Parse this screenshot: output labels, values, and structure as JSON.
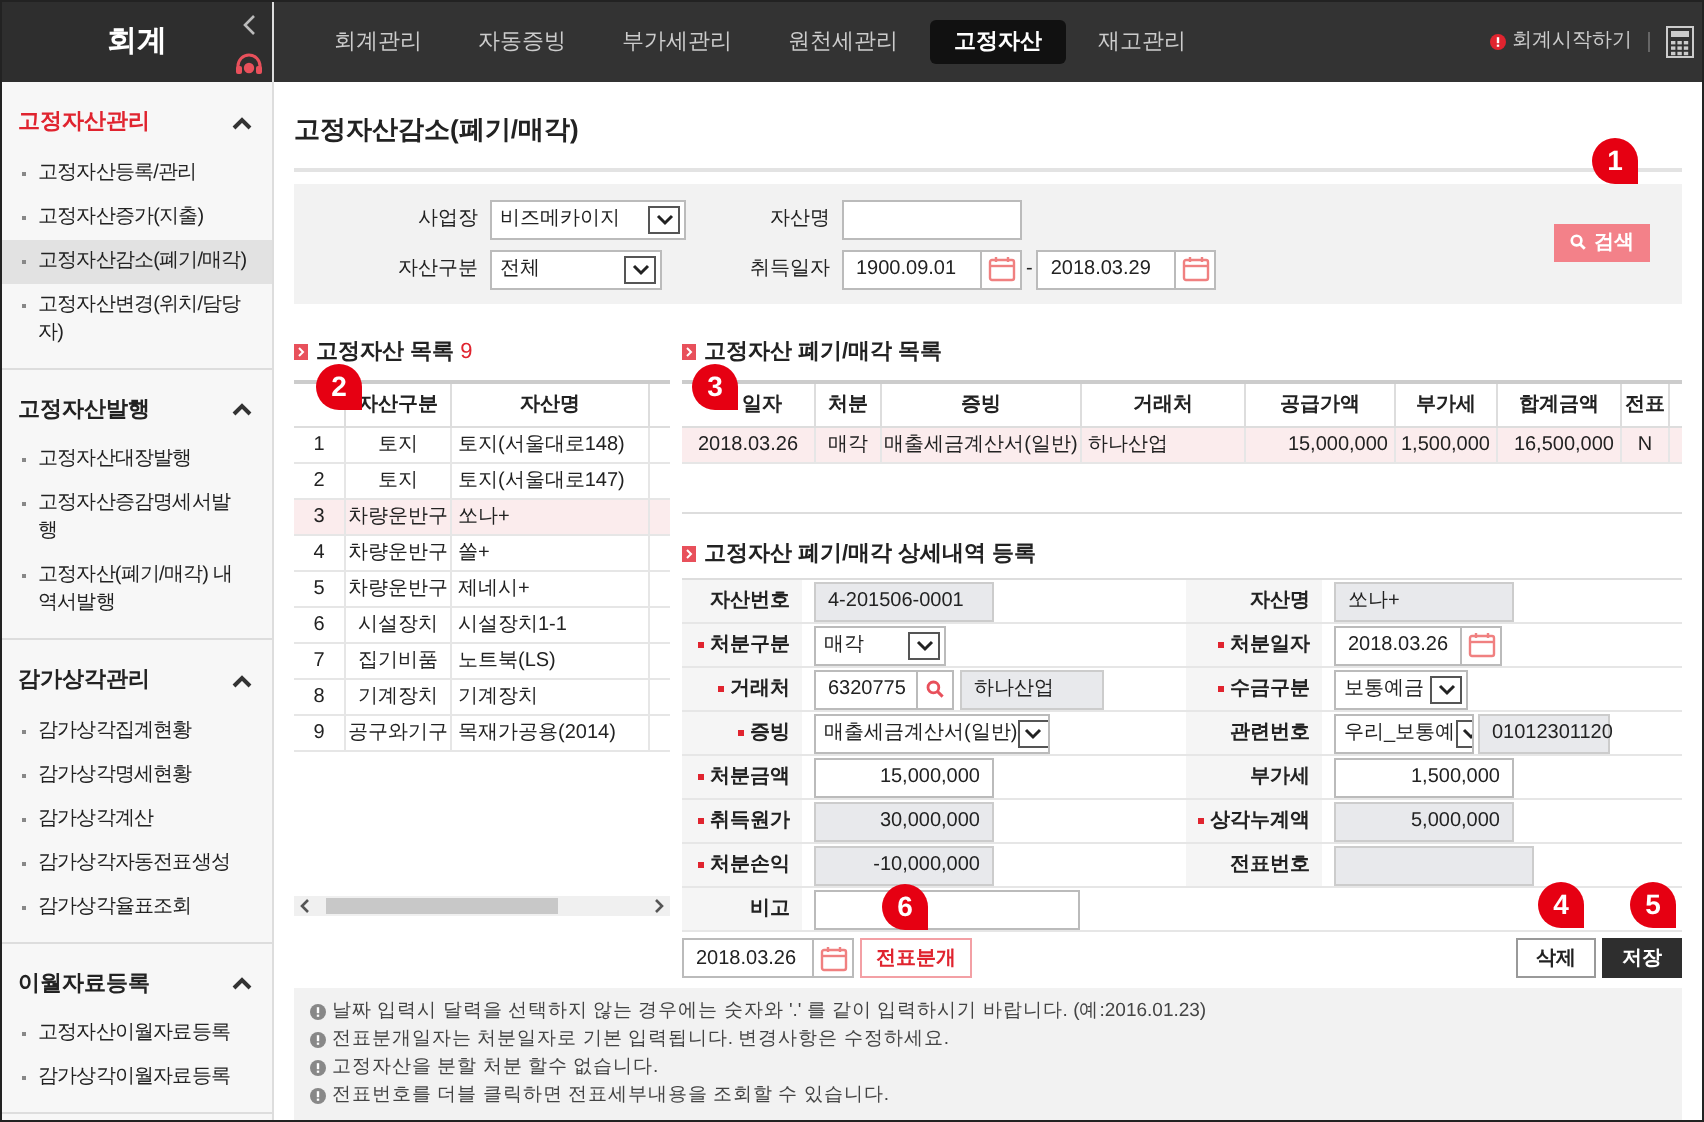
{
  "app_title": "회계",
  "top_nav": [
    {
      "label": "회계관리",
      "selected": false
    },
    {
      "label": "자동증빙",
      "selected": false
    },
    {
      "label": "부가세관리",
      "selected": false
    },
    {
      "label": "원천세관리",
      "selected": false
    },
    {
      "label": "고정자산",
      "selected": true
    },
    {
      "label": "재고관리",
      "selected": false
    }
  ],
  "start_link": "회계시작하기",
  "sidebar": [
    {
      "title": "고정자산관리",
      "selected": true,
      "expanded": true,
      "items": [
        {
          "label": "고정자산등록/관리",
          "selected": false
        },
        {
          "label": "고정자산증가(지출)",
          "selected": false
        },
        {
          "label": "고정자산감소(폐기/매각)",
          "selected": true
        },
        {
          "label": "고정자산변경(위치/담당자)",
          "selected": false
        }
      ]
    },
    {
      "title": "고정자산발행",
      "selected": false,
      "expanded": true,
      "items": [
        {
          "label": "고정자산대장발행",
          "selected": false
        },
        {
          "label": "고정자산증감명세서발행",
          "selected": false
        },
        {
          "label": "고정자산(폐기/매각) 내역서발행",
          "selected": false
        }
      ]
    },
    {
      "title": "감가상각관리",
      "selected": false,
      "expanded": true,
      "items": [
        {
          "label": "감가상각집계현황",
          "selected": false
        },
        {
          "label": "감가상각명세현황",
          "selected": false
        },
        {
          "label": "감가상각계산",
          "selected": false
        },
        {
          "label": "감가상각자동전표생성",
          "selected": false
        },
        {
          "label": "감가상각율표조회",
          "selected": false
        }
      ]
    },
    {
      "title": "이월자료등록",
      "selected": false,
      "expanded": true,
      "items": [
        {
          "label": "고정자산이월자료등록",
          "selected": false
        },
        {
          "label": "감가상각이월자료등록",
          "selected": false
        }
      ]
    }
  ],
  "page_title": "고정자산감소(폐기/매각)",
  "filters": {
    "business": {
      "label": "사업장",
      "value": "비즈메카이지"
    },
    "asset_name": {
      "label": "자산명"
    },
    "asset_type": {
      "label": "자산구분",
      "value": "전체"
    },
    "acquire_date": {
      "label": "취득일자",
      "from": "1900.09.01",
      "separator": "-",
      "to": "2018.03.29"
    }
  },
  "search_button": "검색",
  "asset_list": {
    "title": "고정자산 목록",
    "count": "9",
    "columns": [
      "",
      "자산구분",
      "자산명"
    ],
    "rows": [
      {
        "cells": [
          "1",
          "토지",
          "토지(서울대로148)"
        ],
        "selected": false
      },
      {
        "cells": [
          "2",
          "토지",
          "토지(서울대로147)"
        ],
        "selected": false
      },
      {
        "cells": [
          "3",
          "차량운반구",
          "쏘나+"
        ],
        "selected": true
      },
      {
        "cells": [
          "4",
          "차량운반구",
          "쏠+"
        ],
        "selected": false
      },
      {
        "cells": [
          "5",
          "차량운반구",
          "제네시+"
        ],
        "selected": false
      },
      {
        "cells": [
          "6",
          "시설장치",
          "시설장치1-1"
        ],
        "selected": false
      },
      {
        "cells": [
          "7",
          "집기비품",
          "노트북(LS)"
        ],
        "selected": false
      },
      {
        "cells": [
          "8",
          "기계장치",
          "기계장치"
        ],
        "selected": false
      },
      {
        "cells": [
          "9",
          "공구와기구",
          "목재가공용(2014)"
        ],
        "selected": false
      }
    ]
  },
  "disposal_list": {
    "title": "고정자산 폐기/매각 목록",
    "columns": [
      "일자",
      "처분",
      "증빙",
      "거래처",
      "공급가액",
      "부가세",
      "합계금액",
      "전표"
    ],
    "rows": [
      {
        "cells": [
          "2018.03.26",
          "매각",
          "매출세금계산서(일반)",
          "하나산업",
          "15,000,000",
          "1,500,000",
          "16,500,000",
          "N"
        ],
        "selected": true
      }
    ]
  },
  "detail": {
    "title": "고정자산 폐기/매각 상세내역 등록",
    "fields": [
      {
        "label": "자산번호",
        "required": false,
        "kind": "readonly",
        "value": "4-201506-0001"
      },
      {
        "label": "자산명",
        "required": false,
        "kind": "readonly",
        "value": "쏘나+"
      },
      {
        "label": "처분구분",
        "required": true,
        "kind": "select",
        "value": "매각"
      },
      {
        "label": "처분일자",
        "required": true,
        "kind": "date",
        "value": "2018.03.26"
      },
      {
        "label": "거래처",
        "required": true,
        "kind": "lookup",
        "value": "6320775",
        "extra": "하나산업"
      },
      {
        "label": "수금구분",
        "required": true,
        "kind": "select",
        "value": "보통예금"
      },
      {
        "label": "증빙",
        "required": true,
        "kind": "select",
        "value": "매출세금계산서(일반)"
      },
      {
        "label": "관련번호",
        "required": false,
        "kind": "select",
        "value": "우리_보통예",
        "extra": "01012301120"
      },
      {
        "label": "처분금액",
        "required": true,
        "kind": "number",
        "value": "15,000,000"
      },
      {
        "label": "부가세",
        "required": false,
        "kind": "number",
        "value": "1,500,000"
      },
      {
        "label": "취득원가",
        "required": true,
        "kind": "readonly_number",
        "value": "30,000,000"
      },
      {
        "label": "상각누계액",
        "required": true,
        "kind": "readonly_number",
        "value": "5,000,000"
      },
      {
        "label": "처분손익",
        "required": true,
        "kind": "readonly_number",
        "value": "-10,000,000"
      },
      {
        "label": "전표번호",
        "required": false,
        "kind": "readonly"
      },
      {
        "label": "비고",
        "required": false,
        "kind": "text"
      }
    ]
  },
  "voucher_date": "2018.03.26",
  "buttons": [
    {
      "label": "전표분개",
      "kind": "outline"
    },
    {
      "label": "삭제",
      "kind": "default"
    },
    {
      "label": "저장",
      "kind": "dark"
    }
  ],
  "notes": [
    "날짜 입력시 달력을 선택하지 않는 경우에는 숫자와 '.' 를 같이 입력하시기 바랍니다. (예:2016.01.23)",
    "전표분개일자는 처분일자로 기본 입력됩니다. 변경사항은 수정하세요.",
    "고정자산을 분할 처분 할수 없습니다.",
    "전표번호를 더블 클릭하면 전표세부내용을 조회할 수 있습니다."
  ],
  "callouts": [
    "1",
    "2",
    "3",
    "6",
    "4",
    "5"
  ]
}
